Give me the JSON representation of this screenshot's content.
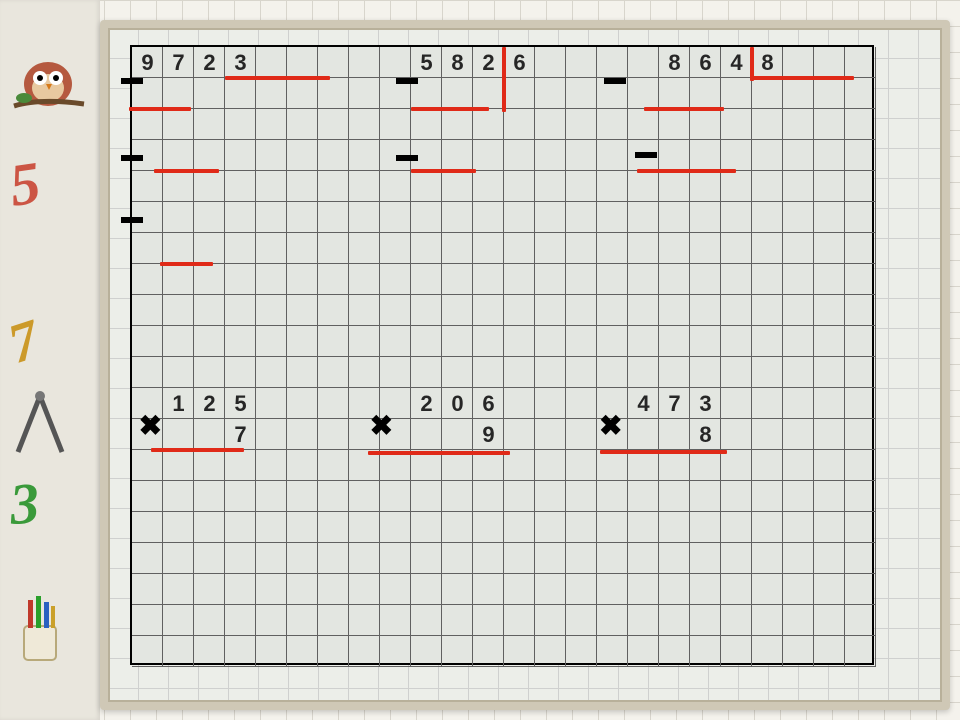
{
  "grid": {
    "cols": 24,
    "rows": 20,
    "cell": 31
  },
  "division_problems": [
    {
      "digits": [
        {
          "r": 0,
          "c": 0,
          "v": "9"
        },
        {
          "r": 0,
          "c": 1,
          "v": "7"
        },
        {
          "r": 0,
          "c": 2,
          "v": "2"
        },
        {
          "r": 0,
          "c": 3,
          "v": "3"
        }
      ]
    },
    {
      "digits": [
        {
          "r": 0,
          "c": 9,
          "v": "5"
        },
        {
          "r": 0,
          "c": 10,
          "v": "8"
        },
        {
          "r": 0,
          "c": 11,
          "v": "2"
        },
        {
          "r": 0,
          "c": 12,
          "v": "6"
        }
      ]
    },
    {
      "digits": [
        {
          "r": 0,
          "c": 17,
          "v": "8"
        },
        {
          "r": 0,
          "c": 18,
          "v": "6"
        },
        {
          "r": 0,
          "c": 19,
          "v": "4"
        },
        {
          "r": 0,
          "c": 20,
          "v": "8"
        }
      ]
    }
  ],
  "multiplication_problems": [
    {
      "digits": [
        {
          "r": 11,
          "c": 1,
          "v": "1"
        },
        {
          "r": 11,
          "c": 2,
          "v": "2"
        },
        {
          "r": 11,
          "c": 3,
          "v": "5"
        },
        {
          "r": 12,
          "c": 3,
          "v": "7"
        }
      ]
    },
    {
      "digits": [
        {
          "r": 11,
          "c": 9,
          "v": "2"
        },
        {
          "r": 11,
          "c": 10,
          "v": "0"
        },
        {
          "r": 11,
          "c": 11,
          "v": "6"
        },
        {
          "r": 12,
          "c": 11,
          "v": "9"
        }
      ]
    },
    {
      "digits": [
        {
          "r": 11,
          "c": 16,
          "v": "4"
        },
        {
          "r": 11,
          "c": 17,
          "v": "7"
        },
        {
          "r": 11,
          "c": 18,
          "v": "3"
        },
        {
          "r": 12,
          "c": 18,
          "v": "8"
        }
      ]
    }
  ],
  "minus_signs": [
    {
      "r": 0.6,
      "c": -0.5
    },
    {
      "r": 3.1,
      "c": -0.5
    },
    {
      "r": 5.1,
      "c": -0.5
    },
    {
      "r": 0.6,
      "c": 8.4
    },
    {
      "r": 3.1,
      "c": 8.4
    },
    {
      "r": 0.6,
      "c": 15.1
    },
    {
      "r": 3.0,
      "c": 16.1
    }
  ],
  "mult_signs": [
    {
      "r": 11.6,
      "c": 0.15
    },
    {
      "r": 11.6,
      "c": 7.6
    },
    {
      "r": 11.6,
      "c": 15.0
    }
  ],
  "red_h_lines": [
    {
      "r": 1,
      "c": 3,
      "len": 3.4
    },
    {
      "r": 2,
      "c": -0.1,
      "len": 2.0
    },
    {
      "r": 4,
      "c": 0.7,
      "len": 2.1
    },
    {
      "r": 7,
      "c": 0.9,
      "len": 1.7
    },
    {
      "r": 2,
      "c": 9,
      "len": 2.5
    },
    {
      "r": 4,
      "c": 9,
      "len": 2.1
    },
    {
      "r": 1,
      "c": 20,
      "len": 3.3
    },
    {
      "r": 2,
      "c": 16.5,
      "len": 2.6
    },
    {
      "r": 4,
      "c": 16.3,
      "len": 3.2
    },
    {
      "r": 13,
      "c": 0.6,
      "len": 3.0
    },
    {
      "r": 13.1,
      "c": 7.6,
      "len": 4.6
    },
    {
      "r": 13.05,
      "c": 15.1,
      "len": 4.1
    }
  ],
  "red_v_lines": [
    {
      "r": 0,
      "c": 12,
      "len": 2.1
    },
    {
      "r": 0,
      "c": 20,
      "len": 1.1
    }
  ],
  "decor": {
    "bear_label": "owl-on-branch",
    "compass_label": "divider-compass",
    "cup_label": "pencil-cup"
  }
}
